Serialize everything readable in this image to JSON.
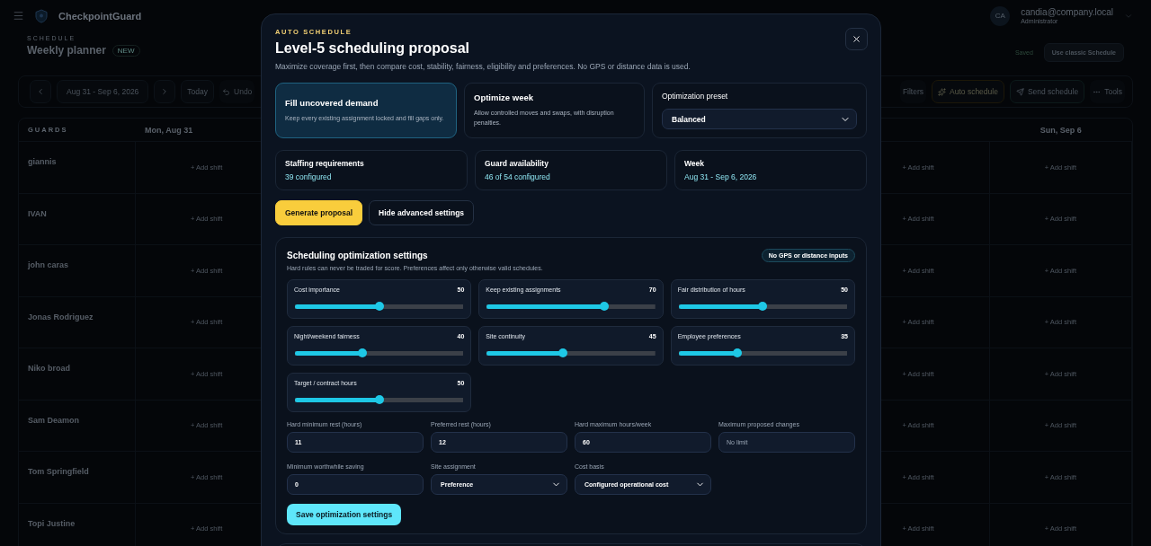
{
  "header": {
    "app_name": "CheckpointGuard",
    "user": {
      "initials": "CA",
      "email": "candia@company.local",
      "role": "Administrator"
    }
  },
  "page": {
    "eyebrow": "SCHEDULE",
    "title": "Weekly planner",
    "badge": "NEW",
    "save_status": "Saved",
    "classic_button": "Use classic Schedule"
  },
  "toolbar": {
    "range": "Aug 31 - Sep 6, 2026",
    "today": "Today",
    "undo": "Undo",
    "filters": "Filters",
    "auto_schedule": "Auto schedule",
    "send": "Send schedule",
    "tools": "Tools"
  },
  "grid": {
    "guards_heading": "GUARDS",
    "first_day": "Mon, Aug 31",
    "last_day": "Sun, Sep 6",
    "rows": [
      {
        "name": "giannis",
        "cells": [
          "+ Add shift",
          "+ Add shift",
          "+ Add shift"
        ]
      },
      {
        "name": "IVAN",
        "cells": [
          "+ Add shift",
          "+ Add shift",
          "+ Add shift"
        ]
      },
      {
        "name": "john caras",
        "cells": [
          "+ Add shift",
          "+ Add shift",
          "+ Add shift"
        ]
      },
      {
        "name": "Jonas Rodriguez",
        "cells": [
          "+ Add shift",
          "+ Add shift",
          "+ Add shift"
        ]
      },
      {
        "name": "Niko broad",
        "cells": [
          "+ Add shift",
          "+ Add shift",
          "+ Add shift"
        ]
      },
      {
        "name": "Sam Deamon",
        "cells": [
          "+ Add shift",
          "+ Add shift",
          "+ Add shift"
        ]
      },
      {
        "name": "Tom Springfield",
        "cells": [
          "+ Add shift",
          "+ Add shift",
          "+ Add shift"
        ]
      },
      {
        "name": "Topi Justine",
        "cells": [
          "+ Add shift",
          "+ Add shift",
          "+ Add shift"
        ]
      }
    ]
  },
  "modal": {
    "eyebrow": "AUTO SCHEDULE",
    "title": "Level-5 scheduling proposal",
    "description": "Maximize coverage first, then compare cost, stability, fairness, eligibility and preferences. No GPS or distance data is used.",
    "modes": [
      {
        "title": "Fill uncovered demand",
        "description": "Keep every existing assignment locked and fill gaps only.",
        "selected": true
      },
      {
        "title": "Optimize week",
        "description": "Allow controlled moves and swaps, with disruption penalties.",
        "selected": false
      }
    ],
    "preset": {
      "label": "Optimization preset",
      "value": "Balanced"
    },
    "stats": [
      {
        "label": "Staffing requirements",
        "value": "39 configured"
      },
      {
        "label": "Guard availability",
        "value": "46 of 54 configured"
      },
      {
        "label": "Week",
        "value": "Aug 31 - Sep 6, 2026"
      }
    ],
    "actions": [
      {
        "label": "Generate proposal",
        "kind": "primary"
      },
      {
        "label": "Hide advanced settings",
        "kind": "secondary"
      }
    ],
    "settings": {
      "title": "Scheduling optimization settings",
      "badge": "No GPS or distance inputs",
      "description": "Hard rules can never be traded for score. Preferences affect only otherwise valid schedules.",
      "sliders": [
        {
          "label": "Cost importance",
          "value": "50",
          "level": 0.5
        },
        {
          "label": "Keep existing assignments",
          "value": "70",
          "level": 0.7
        },
        {
          "label": "Fair distribution of hours",
          "value": "50",
          "level": 0.5
        },
        {
          "label": "Night/weekend fairness",
          "value": "40",
          "level": 0.4
        },
        {
          "label": "Site continuity",
          "value": "45",
          "level": 0.45
        },
        {
          "label": "Employee preferences",
          "value": "35",
          "level": 0.35
        },
        {
          "label": "Target / contract hours",
          "value": "50",
          "level": 0.5
        }
      ],
      "fields": [
        {
          "label": "Hard minimum rest (hours)",
          "kind": "input",
          "value": "11"
        },
        {
          "label": "Preferred rest (hours)",
          "kind": "input",
          "value": "12"
        },
        {
          "label": "Hard maximum hours/week",
          "kind": "input",
          "value": "60"
        },
        {
          "label": "Maximum proposed changes",
          "kind": "input",
          "placeholder": "No limit"
        },
        {
          "label": "Minimum worthwhile saving",
          "kind": "input",
          "value": "0"
        },
        {
          "label": "Site assignment",
          "kind": "select",
          "value": "Preference"
        },
        {
          "label": "Cost basis",
          "kind": "select",
          "value": "Configured operational cost"
        }
      ],
      "save": "Save optimization settings"
    }
  }
}
